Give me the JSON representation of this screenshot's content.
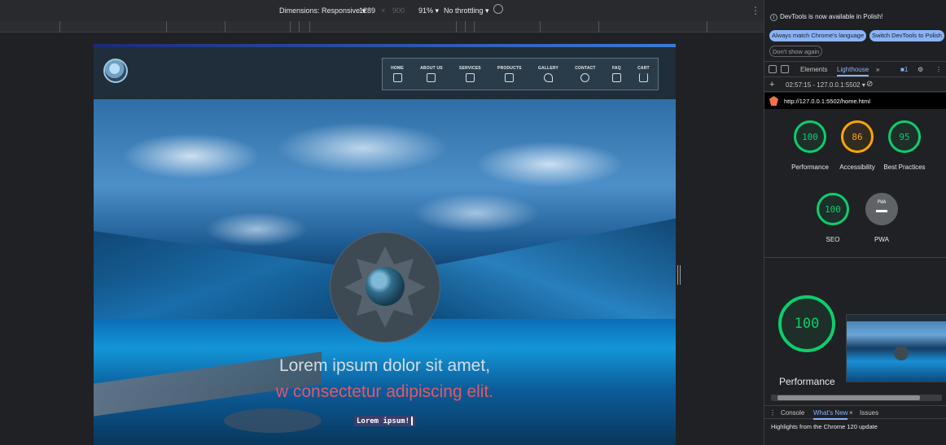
{
  "device_toolbar": {
    "dimensions_label": "Dimensions: Responsive ▾",
    "width_value": "1289",
    "times": "×",
    "height_placeholder": "900",
    "zoom": "91% ▾",
    "throttle": "No throttling ▾",
    "kebab": "⋮"
  },
  "site": {
    "nav": [
      {
        "label": "HOME"
      },
      {
        "label": "ABOUT US"
      },
      {
        "label": "SERVICES"
      },
      {
        "label": "PRODUCTS"
      },
      {
        "label": "GALLERY"
      },
      {
        "label": "CONTACT"
      },
      {
        "label": "FAQ"
      },
      {
        "label": "CART"
      }
    ],
    "hero_line1": "Lorem ipsum dolor sit amet,",
    "hero_line2": "w consectetur adipiscing elit.",
    "hero_cta": "Lorem ipsum!"
  },
  "devtools": {
    "infobar_text": "DevTools is now available in Polish!",
    "info_icon": "i",
    "btn_match": "Always match Chrome's language",
    "btn_switch": "Switch DevTools to Polish",
    "btn_dont_show": "Don't show again",
    "tabs": {
      "elements": "Elements",
      "lighthouse": "Lighthouse",
      "more": "»",
      "badge": "1",
      "kebab": "⋮"
    },
    "report": {
      "plus": "+",
      "label": "02:57:15 - 127.0.0.1:5502 ▾",
      "clear": "⊘"
    },
    "url": "http://127.0.0.1:5502/home.html",
    "scores": [
      {
        "label": "Performance",
        "value": "100",
        "status": "#0cce6b"
      },
      {
        "label": "Accessibility",
        "value": "86",
        "status": "#ffa400"
      },
      {
        "label": "Best Practices",
        "value": "95",
        "status": "#0cce6b"
      },
      {
        "label": "SEO",
        "value": "100",
        "status": "#0cce6b"
      },
      {
        "label": "PWA",
        "value": "PWA",
        "status": "#5f6368"
      }
    ],
    "summary": {
      "value": "100",
      "label": "Performance"
    },
    "drawer": {
      "kebab": "⋮",
      "console": "Console",
      "whats_new": "What's New",
      "close": "×",
      "issues": "Issues",
      "body": "Highlights from the Chrome 120 update"
    }
  }
}
